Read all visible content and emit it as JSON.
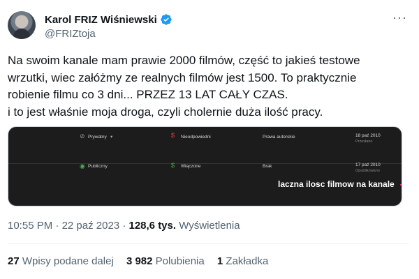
{
  "author": {
    "display_name": "Karol FRIZ Wiśniewski",
    "handle": "@FRIZtoja",
    "verified_color": "#1d9bf0"
  },
  "tweet": {
    "lines": [
      "Na swoim kanale mam prawie 2000 filmów, część to jakieś testowe",
      "wrzutki, wiec załóżmy ze realnych filmów jest 1500. To praktycznie",
      "robienie filmu co 3 dni... PRZEZ 13 LAT CAŁY CZAS.",
      "i to jest właśnie moja droga, czyli cholernie duża ilość pracy."
    ]
  },
  "media": {
    "rows": [
      {
        "visibility": "Prywatny",
        "visibility_icon": "eye-off-icon",
        "monetization": "Nieodpowiedni",
        "monetization_icon": "dollar-off-icon",
        "restriction": "Prawa autorskie",
        "date": "18 paź 2010",
        "date_sub": "Przesłano"
      },
      {
        "visibility": "Publiczny",
        "visibility_icon": "eye-icon",
        "monetization": "Włączone",
        "monetization_icon": "dollar-icon",
        "restriction": "Brak",
        "date": "17 paź 2010",
        "date_sub": "Opublikowano"
      }
    ],
    "overlay_text": "laczna ilosc filmow na kanale"
  },
  "meta": {
    "time": "10:55 PM",
    "separator": "·",
    "date": "22 paź 2023",
    "views": "128,6 tys.",
    "views_label": "Wyświetlenia"
  },
  "stats": {
    "reposts_count": "27",
    "reposts_label": "Wpisy podane dalej",
    "likes_count": "3 982",
    "likes_label": "Polubienia",
    "bookmarks_count": "1",
    "bookmarks_label": "Zakładka"
  },
  "icons": {
    "more": "more-options-icon"
  }
}
